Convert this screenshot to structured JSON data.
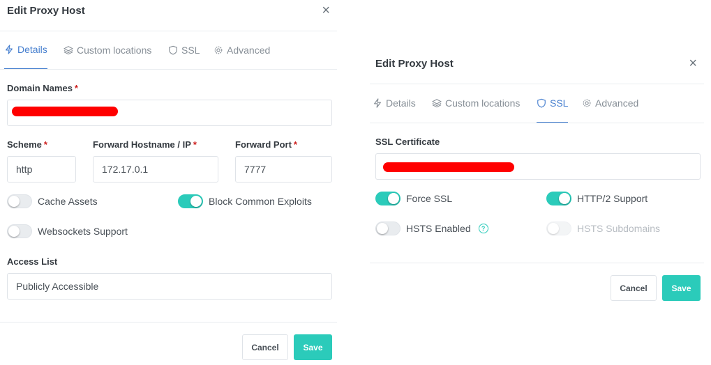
{
  "left_modal": {
    "title": "Edit Proxy Host",
    "close": "×",
    "tabs": [
      {
        "label": "Details",
        "icon": "lightning-icon"
      },
      {
        "label": "Custom locations",
        "icon": "layers-icon"
      },
      {
        "label": "SSL",
        "icon": "shield-icon"
      },
      {
        "label": "Advanced",
        "icon": "gear-icon"
      }
    ],
    "domain_names_label": "Domain Names",
    "required_mark": "*",
    "scheme_label": "Scheme",
    "scheme_value": "http",
    "forward_host_label": "Forward Hostname / IP",
    "forward_host_value": "172.17.0.1",
    "forward_port_label": "Forward Port",
    "forward_port_value": "7777",
    "cache_assets_label": "Cache Assets",
    "block_exploits_label": "Block Common Exploits",
    "websockets_label": "Websockets Support",
    "access_list_label": "Access List",
    "access_list_value": "Publicly Accessible",
    "cancel_label": "Cancel",
    "save_label": "Save"
  },
  "right_modal": {
    "title": "Edit Proxy Host",
    "close": "×",
    "tabs": [
      {
        "label": "Details",
        "icon": "lightning-icon"
      },
      {
        "label": "Custom locations",
        "icon": "layers-icon"
      },
      {
        "label": "SSL",
        "icon": "shield-icon"
      },
      {
        "label": "Advanced",
        "icon": "gear-icon"
      }
    ],
    "ssl_certificate_label": "SSL Certificate",
    "force_ssl_label": "Force SSL",
    "http2_label": "HTTP/2 Support",
    "hsts_enabled_label": "HSTS Enabled",
    "help_glyph": "?",
    "hsts_subdomains_label": "HSTS Subdomains",
    "cancel_label": "Cancel",
    "save_label": "Save"
  },
  "colors": {
    "accent": "#2bcbba",
    "active_tab": "#467fcf",
    "required": "#cd201f",
    "redaction": "#ff0000"
  },
  "toggle_states": {
    "cache_assets": false,
    "block_common_exploits": true,
    "websockets_support": false,
    "force_ssl": true,
    "http2_support": true,
    "hsts_enabled": false,
    "hsts_subdomains": false
  }
}
